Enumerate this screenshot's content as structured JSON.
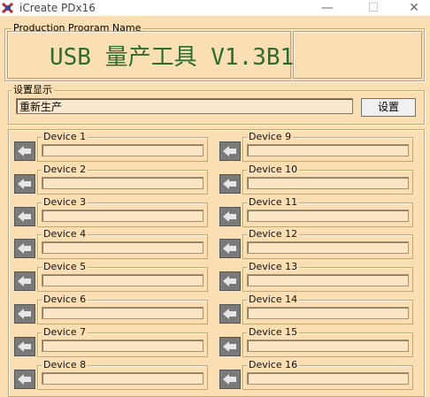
{
  "window": {
    "title": "iCreate PDx16",
    "minimize_glyph": "—",
    "maximize_glyph": "☐",
    "close_glyph": "✕"
  },
  "program_group": {
    "legend": "Production Program Name",
    "title": "USB 量产工具 V1.3B1"
  },
  "settings_group": {
    "legend": "设置显示",
    "field_value": "重新生产",
    "button_label": "设置"
  },
  "devices_left": [
    {
      "label": "Device 1",
      "progress": 0
    },
    {
      "label": "Device 2",
      "progress": 0
    },
    {
      "label": "Device 3",
      "progress": 0
    },
    {
      "label": "Device 4",
      "progress": 0
    },
    {
      "label": "Device 5",
      "progress": 0
    },
    {
      "label": "Device 6",
      "progress": 0
    },
    {
      "label": "Device 7",
      "progress": 0
    },
    {
      "label": "Device 8",
      "progress": 0
    }
  ],
  "devices_right": [
    {
      "label": "Device 9",
      "progress": 0
    },
    {
      "label": "Device 10",
      "progress": 0
    },
    {
      "label": "Device 11",
      "progress": 0
    },
    {
      "label": "Device 12",
      "progress": 0
    },
    {
      "label": "Device 13",
      "progress": 0
    },
    {
      "label": "Device 14",
      "progress": 0
    },
    {
      "label": "Device 15",
      "progress": 0
    },
    {
      "label": "Device 16",
      "progress": 0
    }
  ],
  "colors": {
    "background": "#fbdfb4",
    "title_text": "#2f6b2f",
    "device_icon": "#7a7a7a"
  },
  "icons": {
    "app": "app-logo-icon",
    "device_status": "arrow-left-icon"
  }
}
